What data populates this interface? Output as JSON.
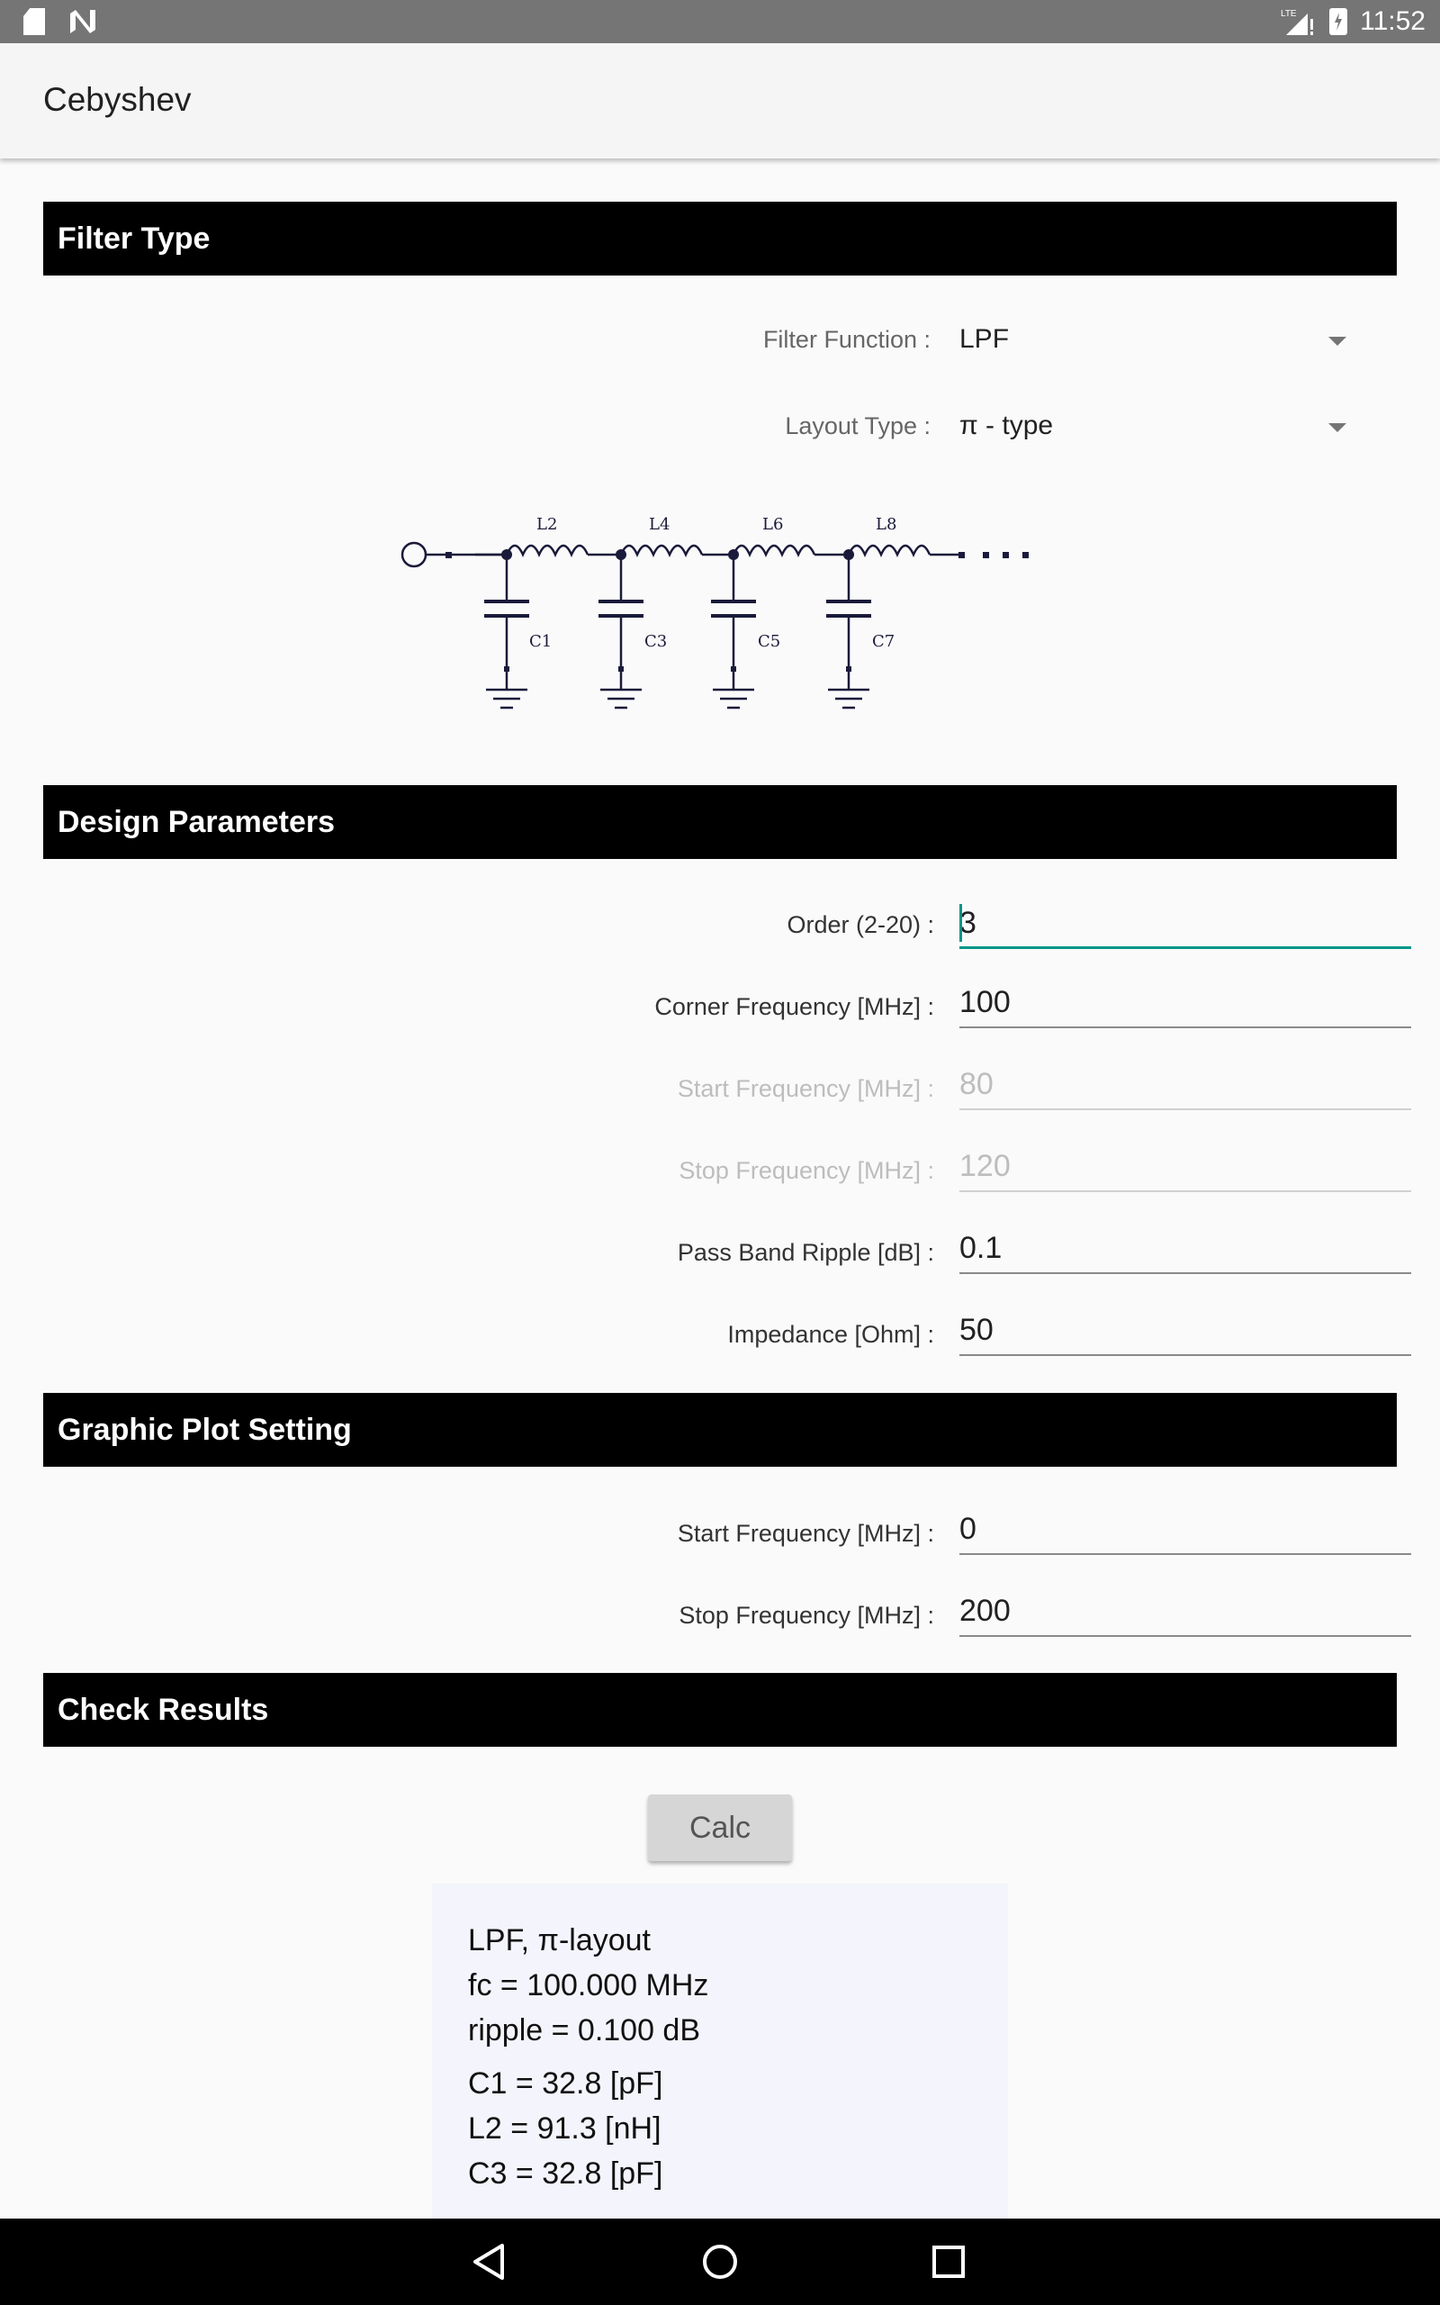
{
  "status_bar": {
    "time": "11:52",
    "lte": "LTE"
  },
  "app": {
    "title": "Cebyshev"
  },
  "sections": {
    "filter_type": "Filter Type",
    "design_parameters": "Design Parameters",
    "graphic_plot": "Graphic Plot Setting",
    "check_results": "Check Results"
  },
  "filter_type": {
    "function_label": "Filter Function :",
    "function_value": "LPF",
    "layout_label": "Layout Type :",
    "layout_value": "π - type"
  },
  "schematic": {
    "inductors": [
      "L2",
      "L4",
      "L6",
      "L8"
    ],
    "capacitors": [
      "C1",
      "C3",
      "C5",
      "C7"
    ]
  },
  "design": {
    "order_label": "Order (2-20) :",
    "order_value": "3",
    "corner_label": "Corner Frequency [MHz] :",
    "corner_value": "100",
    "start_label": "Start Frequency [MHz] :",
    "start_value": "80",
    "stop_label": "Stop Frequency [MHz] :",
    "stop_value": "120",
    "ripple_label": "Pass Band Ripple [dB] :",
    "ripple_value": "0.1",
    "impedance_label": "Impedance [Ohm] :",
    "impedance_value": "50"
  },
  "plot": {
    "start_label": "Start Frequency [MHz] :",
    "start_value": "0",
    "stop_label": "Stop Frequency [MHz] :",
    "stop_value": "200"
  },
  "calc_label": "Calc",
  "results": {
    "line1": "LPF, π-layout",
    "line2": "fc = 100.000 MHz",
    "line3": "ripple = 0.100 dB",
    "line4": "C1 = 32.8 [pF]",
    "line5": "L2 = 91.3 [nH]",
    "line6": "C3 = 32.8 [pF]"
  }
}
